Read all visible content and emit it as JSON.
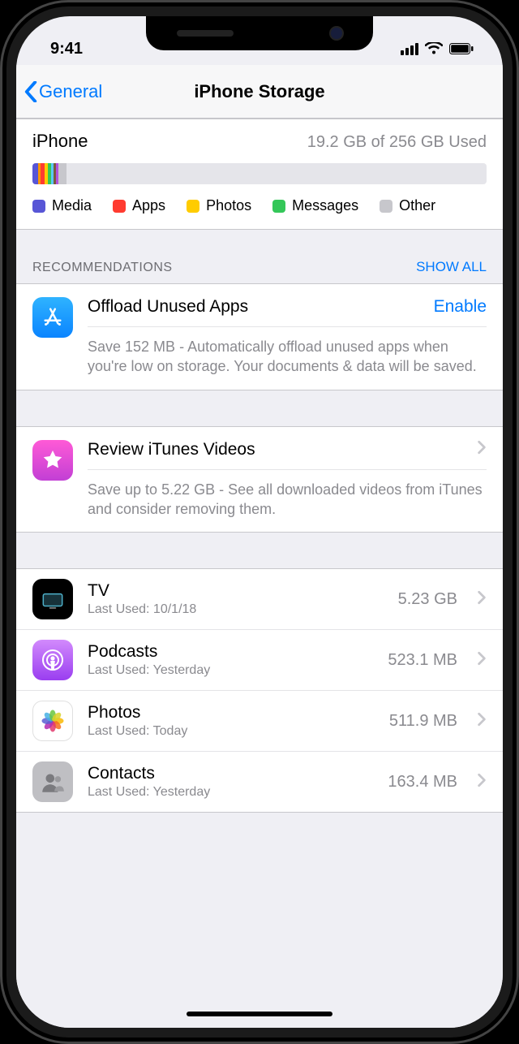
{
  "status": {
    "time": "9:41"
  },
  "nav": {
    "back": "General",
    "title": "iPhone Storage"
  },
  "storage": {
    "device": "iPhone",
    "usage": "19.2 GB of 256 GB Used",
    "legend": [
      {
        "label": "Media",
        "color": "#5856d6"
      },
      {
        "label": "Apps",
        "color": "#ff3b30"
      },
      {
        "label": "Photos",
        "color": "#ffcc00"
      },
      {
        "label": "Messages",
        "color": "#34c759"
      },
      {
        "label": "Other",
        "color": "#c7c7cc"
      }
    ],
    "segments": [
      {
        "color": "#5856d6",
        "pct": 1.2
      },
      {
        "color": "#ff9500",
        "pct": 0.6
      },
      {
        "color": "#ff3b30",
        "pct": 0.9
      },
      {
        "color": "#ffcc00",
        "pct": 0.7
      },
      {
        "color": "#34c759",
        "pct": 0.8
      },
      {
        "color": "#5ac8fa",
        "pct": 0.5
      },
      {
        "color": "#7a5c3b",
        "pct": 0.5
      },
      {
        "color": "#af52de",
        "pct": 0.5
      },
      {
        "color": "#c7c7cc",
        "pct": 1.8
      }
    ]
  },
  "recommendations": {
    "header": "RECOMMENDATIONS",
    "show_all": "SHOW ALL",
    "items": [
      {
        "icon": "appstore",
        "title": "Offload Unused Apps",
        "action": "Enable",
        "action_type": "button",
        "desc": "Save 152 MB - Automatically offload unused apps when you're low on storage. Your documents & data will be saved."
      },
      {
        "icon": "itunes",
        "title": "Review iTunes Videos",
        "action": "",
        "action_type": "disclosure",
        "desc": "Save up to 5.22 GB - See all downloaded videos from iTunes and consider removing them."
      }
    ]
  },
  "apps": [
    {
      "icon": "tv",
      "name": "TV",
      "sub": "Last Used: 10/1/18",
      "size": "5.23 GB"
    },
    {
      "icon": "podcasts",
      "name": "Podcasts",
      "sub": "Last Used: Yesterday",
      "size": "523.1 MB"
    },
    {
      "icon": "photos",
      "name": "Photos",
      "sub": "Last Used: Today",
      "size": "511.9 MB"
    },
    {
      "icon": "contacts",
      "name": "Contacts",
      "sub": "Last Used: Yesterday",
      "size": "163.4 MB"
    }
  ]
}
